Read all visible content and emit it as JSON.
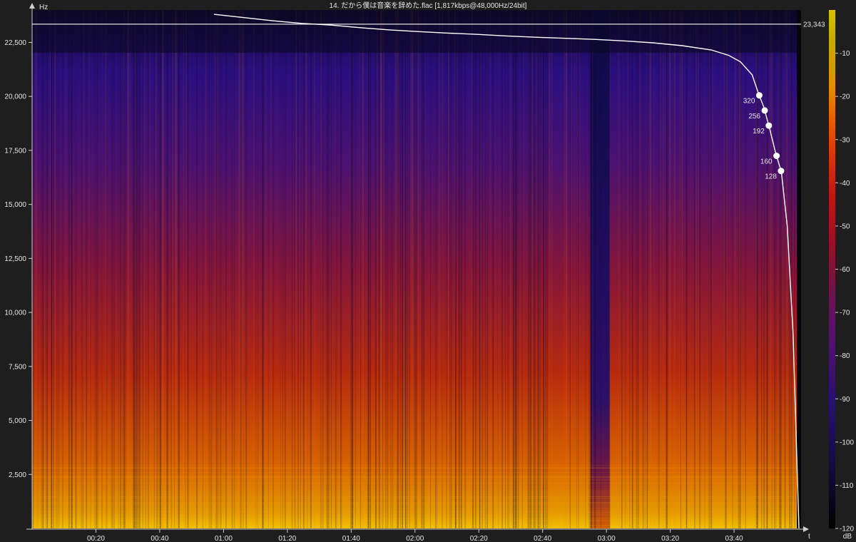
{
  "title": "14. だから僕は音楽を辞めた.flac [1,817kbps@48,000Hz/24bit]",
  "chart_data": {
    "type": "heatmap",
    "title": "14. だから僕は音楽を辞めた.flac [1,817kbps@48,000Hz/24bit]",
    "y_axis": {
      "label": "Hz",
      "range": [
        0,
        24000
      ],
      "ticks": [
        2500,
        5000,
        7500,
        10000,
        12500,
        15000,
        17500,
        20000,
        22500
      ],
      "tick_labels": [
        "2,500",
        "5,000",
        "7,500",
        "10,000",
        "12,500",
        "15,000",
        "17,500",
        "20,000",
        "22,500"
      ]
    },
    "x_axis": {
      "label": "t",
      "range_seconds": [
        0,
        241
      ],
      "ticks_seconds": [
        20,
        40,
        60,
        80,
        100,
        120,
        140,
        160,
        180,
        200,
        220
      ],
      "tick_labels": [
        "00:20",
        "00:40",
        "01:00",
        "01:20",
        "01:40",
        "02:00",
        "02:20",
        "02:40",
        "03:00",
        "03:20",
        "03:40"
      ]
    },
    "colorbar": {
      "label": "dB",
      "range": [
        -120,
        0
      ],
      "ticks": [
        -10,
        -20,
        -30,
        -40,
        -50,
        -60,
        -70,
        -80,
        -90,
        -100,
        -110,
        -120
      ],
      "tick_labels": [
        "-10",
        "-20",
        "-30",
        "-40",
        "-50",
        "-60",
        "-70",
        "-80",
        "-90",
        "-100",
        "-110",
        "-120"
      ],
      "colors": [
        "#000000",
        "#150a40",
        "#2a0e7a",
        "#5a1070",
        "#8a1030",
        "#b81a10",
        "#d84a00",
        "#e88a00",
        "#c8a800",
        "#d8c000"
      ]
    },
    "cutoff_line": {
      "label": "23,343",
      "value_hz": 23343
    },
    "cumulative_curve_hz_by_percent": [
      [
        0,
        23800
      ],
      [
        5,
        23650
      ],
      [
        10,
        23500
      ],
      [
        15,
        23380
      ],
      [
        20,
        23300
      ],
      [
        25,
        23180
      ],
      [
        30,
        23080
      ],
      [
        35,
        23000
      ],
      [
        40,
        22930
      ],
      [
        45,
        22870
      ],
      [
        50,
        22800
      ],
      [
        55,
        22740
      ],
      [
        60,
        22690
      ],
      [
        65,
        22640
      ],
      [
        70,
        22570
      ],
      [
        75,
        22480
      ],
      [
        80,
        22350
      ],
      [
        85,
        22150
      ],
      [
        88,
        21900
      ],
      [
        90,
        21600
      ],
      [
        92,
        21000
      ],
      [
        93,
        20200
      ],
      [
        94,
        19500
      ],
      [
        95,
        18500
      ],
      [
        96,
        17400
      ],
      [
        97,
        16500
      ],
      [
        98,
        14000
      ],
      [
        99,
        9000
      ],
      [
        100,
        0
      ]
    ],
    "bitrate_markers": [
      {
        "label": "320",
        "hz": 20050
      },
      {
        "label": "256",
        "hz": 19350
      },
      {
        "label": "192",
        "hz": 18650
      },
      {
        "label": "160",
        "hz": 17250
      },
      {
        "label": "128",
        "hz": 16550
      }
    ],
    "quiet_region_seconds": [
      175,
      181
    ]
  }
}
